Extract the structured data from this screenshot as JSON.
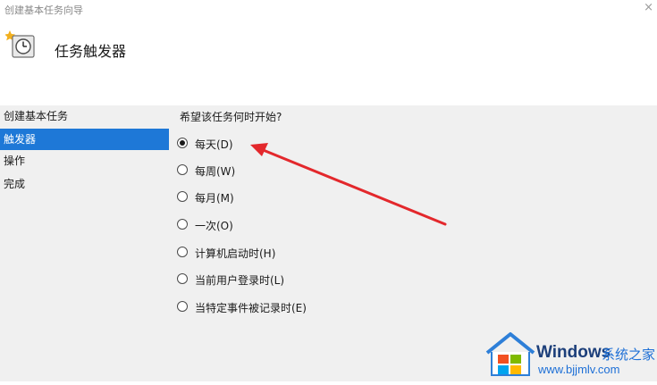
{
  "window": {
    "title": "创建基本任务向导",
    "close_glyph": "×"
  },
  "header": {
    "title": "任务触发器",
    "icon": "task-clock-icon"
  },
  "nav": {
    "items": [
      {
        "label": "创建基本任务",
        "selected": false
      },
      {
        "label": "触发器",
        "selected": true
      },
      {
        "label": "操作",
        "selected": false
      },
      {
        "label": "完成",
        "selected": false
      }
    ]
  },
  "main": {
    "question": "希望该任务何时开始?",
    "options": [
      {
        "label": "每天(D)",
        "checked": true
      },
      {
        "label": "每周(W)",
        "checked": false
      },
      {
        "label": "每月(M)",
        "checked": false
      },
      {
        "label": "一次(O)",
        "checked": false
      },
      {
        "label": "计算机启动时(H)",
        "checked": false
      },
      {
        "label": "当前用户登录时(L)",
        "checked": false
      },
      {
        "label": "当特定事件被记录时(E)",
        "checked": false
      }
    ]
  },
  "annotation": {
    "arrow_color": "#e3282c"
  },
  "watermark": {
    "brand": "Windows",
    "site_name": "系统之家",
    "url": "www.bjjmlv.com"
  },
  "colors": {
    "selection": "#1e78d7",
    "content_bg": "#f0f0f0",
    "watermark_text": "#1d6fd6"
  }
}
